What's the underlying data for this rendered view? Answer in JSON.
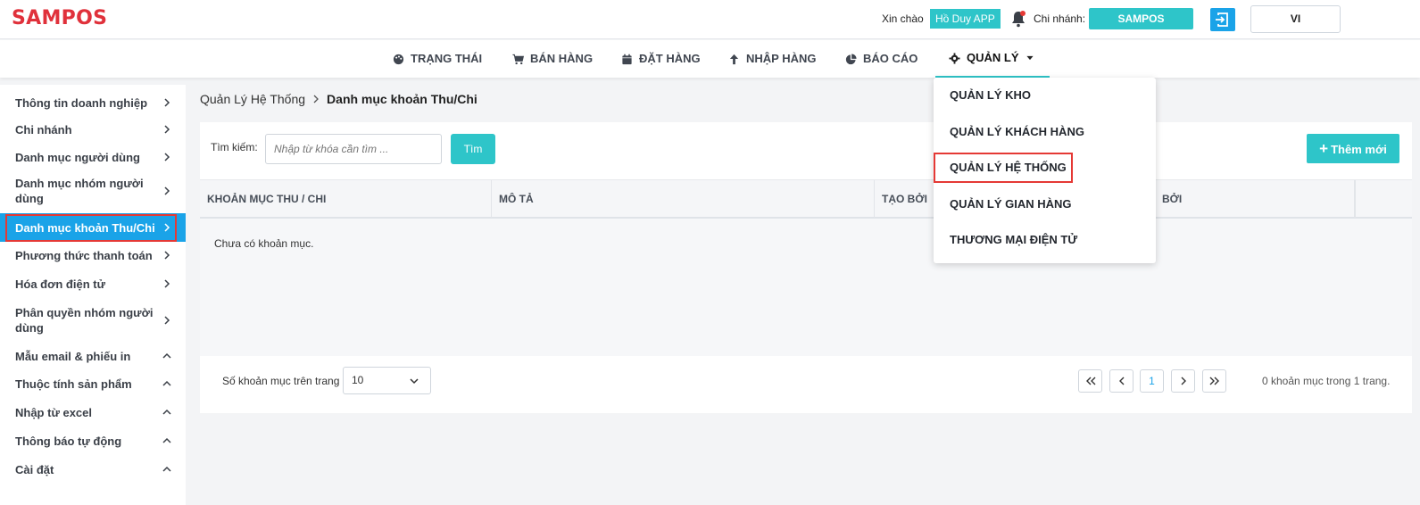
{
  "header": {
    "logo": "SAMPOS",
    "greeting": "Xin chào",
    "user_name": "Hồ Duy APP",
    "branch_label": "Chi nhánh:",
    "branch_value": "SAMPOS",
    "language": "VI"
  },
  "nav": {
    "items": [
      {
        "label": "TRẠNG THÁI",
        "icon": "palette-icon"
      },
      {
        "label": "BÁN HÀNG",
        "icon": "cart-icon"
      },
      {
        "label": "ĐẶT HÀNG",
        "icon": "calendar-icon"
      },
      {
        "label": "NHẬP HÀNG",
        "icon": "arrow-up-icon"
      },
      {
        "label": "BÁO CÁO",
        "icon": "pie-chart-icon"
      },
      {
        "label": "QUẢN LÝ",
        "icon": "gear-icon"
      }
    ],
    "active": "QUẢN LÝ"
  },
  "dropdown": {
    "items": [
      "QUẢN LÝ KHO",
      "QUẢN LÝ KHÁCH HÀNG",
      "QUẢN LÝ HỆ THỐNG",
      "QUẢN LÝ GIAN HÀNG",
      "THƯƠNG MẠI ĐIỆN TỬ"
    ],
    "highlighted": "QUẢN LÝ HỆ THỐNG"
  },
  "sidebar": {
    "items": [
      {
        "label": "Thông tin doanh nghiệp",
        "chevron": "right"
      },
      {
        "label": "Chi nhánh",
        "chevron": "right"
      },
      {
        "label": "Danh mục người dùng",
        "chevron": "right"
      },
      {
        "label": "Danh mục nhóm người dùng",
        "chevron": "right"
      },
      {
        "label": "Danh mục khoản Thu/Chi",
        "chevron": "right"
      },
      {
        "label": "Phương thức thanh toán",
        "chevron": "right"
      },
      {
        "label": "Hóa đơn điện tử",
        "chevron": "right"
      },
      {
        "label": "Phân quyền nhóm người dùng",
        "chevron": "right"
      },
      {
        "label": "Mẫu email & phiếu in",
        "chevron": "up"
      },
      {
        "label": "Thuộc tính sản phẩm",
        "chevron": "up"
      },
      {
        "label": "Nhập từ excel",
        "chevron": "up"
      },
      {
        "label": "Thông báo tự động",
        "chevron": "up"
      },
      {
        "label": "Cài đặt",
        "chevron": "up"
      }
    ],
    "active": "Danh mục khoản Thu/Chi"
  },
  "breadcrumb": {
    "parent": "Quản Lý Hệ Thống",
    "current": "Danh mục khoản Thu/Chi"
  },
  "toolbar": {
    "search_label": "Tìm kiếm:",
    "search_placeholder": "Nhập từ khóa cần tìm ...",
    "search_button": "Tìm",
    "add_button": "Thêm mới"
  },
  "table": {
    "columns": [
      "KHOẢN MỤC THU / CHI",
      "MÔ TẢ",
      "TẠO BỞI",
      "BỞI"
    ],
    "empty_message": "Chưa có khoản mục."
  },
  "pagination": {
    "page_size_label": "Số khoản mục trên trang",
    "page_size": "10",
    "current_page": "1",
    "summary": "0 khoản mục trong 1 trang."
  },
  "colors": {
    "brand_red": "#e0313b",
    "accent_teal": "#2ec5c9",
    "active_blue": "#1aa3e8",
    "highlight_red": "#e53935"
  }
}
